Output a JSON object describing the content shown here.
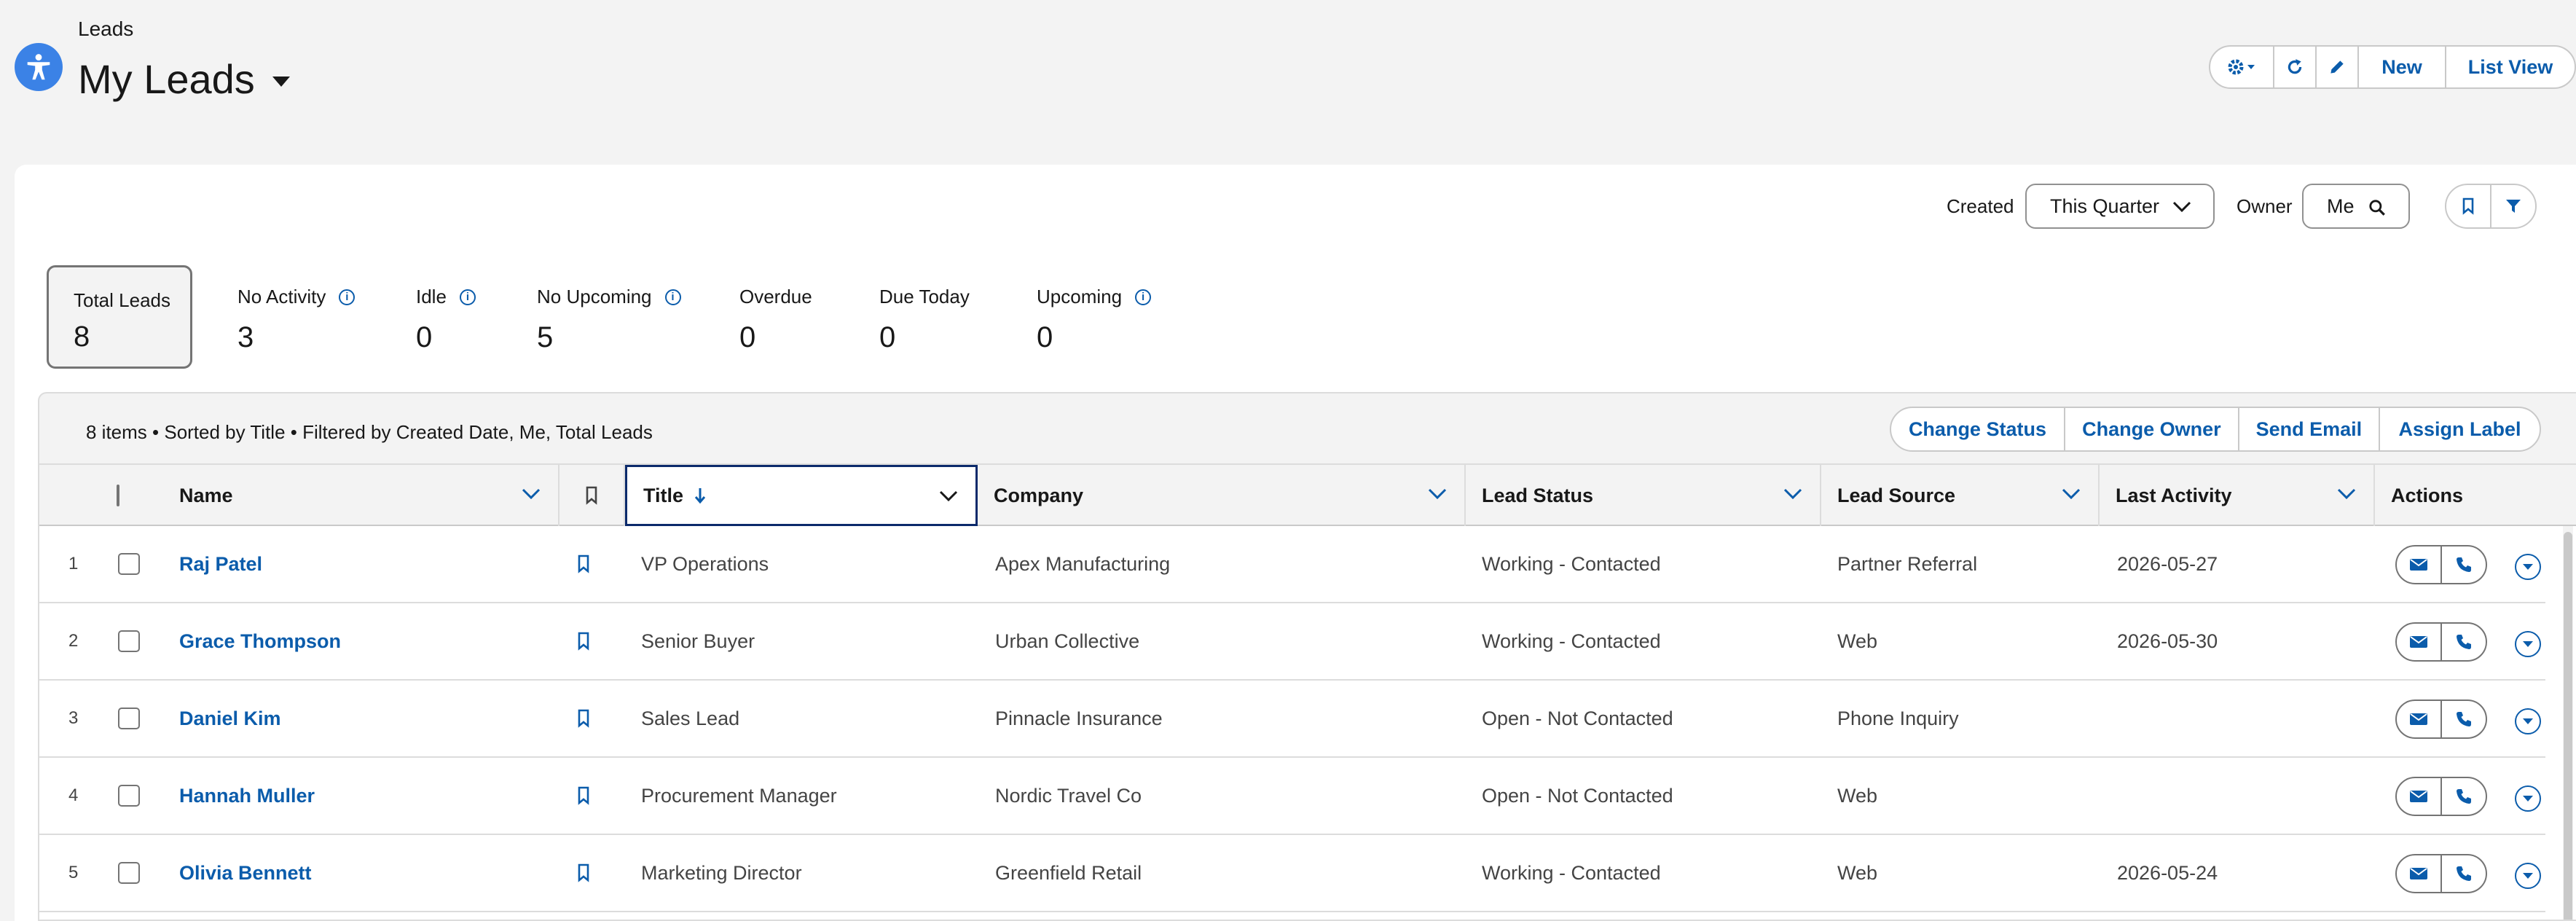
{
  "header": {
    "breadcrumb": "Leads",
    "title": "My Leads",
    "buttons": {
      "new": "New",
      "list_view": "List View"
    }
  },
  "filters": {
    "created_label": "Created",
    "created_value": "This Quarter",
    "owner_label": "Owner",
    "owner_value": "Me"
  },
  "metrics": [
    {
      "label": "Total Leads",
      "value": "8"
    },
    {
      "label": "No Activity",
      "value": "3"
    },
    {
      "label": "Idle",
      "value": "0"
    },
    {
      "label": "No Upcoming",
      "value": "5"
    },
    {
      "label": "Overdue",
      "value": "0"
    },
    {
      "label": "Due Today",
      "value": "0"
    },
    {
      "label": "Upcoming",
      "value": "0"
    }
  ],
  "list": {
    "info": "8 items • Sorted by Title • Filtered by Created Date, Me, Total Leads",
    "actions": [
      "Change Status",
      "Change Owner",
      "Send Email",
      "Assign Label"
    ],
    "columns": {
      "name": "Name",
      "title": "Title",
      "company": "Company",
      "lead_status": "Lead Status",
      "lead_source": "Lead Source",
      "last_activity": "Last Activity",
      "actions": "Actions"
    },
    "rows": [
      {
        "num": "1",
        "name": "Raj Patel",
        "title": "VP Operations",
        "company": "Apex Manufacturing",
        "status": "Working - Contacted",
        "source": "Partner Referral",
        "last_activity": "2026-05-27"
      },
      {
        "num": "2",
        "name": "Grace Thompson",
        "title": "Senior Buyer",
        "company": "Urban Collective",
        "status": "Working - Contacted",
        "source": "Web",
        "last_activity": "2026-05-30"
      },
      {
        "num": "3",
        "name": "Daniel Kim",
        "title": "Sales Lead",
        "company": "Pinnacle Insurance",
        "status": "Open - Not Contacted",
        "source": "Phone Inquiry",
        "last_activity": ""
      },
      {
        "num": "4",
        "name": "Hannah Muller",
        "title": "Procurement Manager",
        "company": "Nordic Travel Co",
        "status": "Open - Not Contacted",
        "source": "Web",
        "last_activity": ""
      },
      {
        "num": "5",
        "name": "Olivia Bennett",
        "title": "Marketing Director",
        "company": "Greenfield Retail",
        "status": "Working - Contacted",
        "source": "Web",
        "last_activity": "2026-05-24"
      }
    ]
  },
  "colors": {
    "brand_blue": "#0b5cab",
    "app_icon": "#3b82e6",
    "border": "#c9c9c9"
  }
}
